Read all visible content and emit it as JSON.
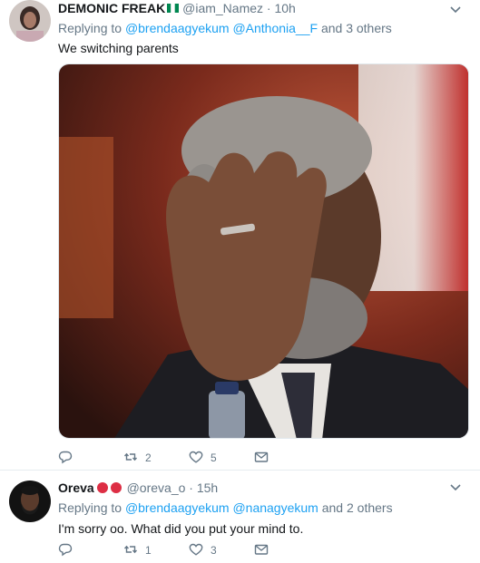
{
  "tweets": [
    {
      "name": "DEMONIC FREAK",
      "handle": "@iam_Namez",
      "separator": "·",
      "time": "10h",
      "replying_prefix": "Replying to ",
      "mention1": "@brendaagyekum",
      "mention2": "@Anthonia__F",
      "replying_suffix": " and 3 others",
      "text": "We switching parents",
      "reply_count": "",
      "retweet_count": "2",
      "like_count": "5",
      "name_emoji": "nigeria-flag"
    },
    {
      "name": "Oreva",
      "handle": "@oreva_o",
      "separator": "·",
      "time": "15h",
      "replying_prefix": "Replying to ",
      "mention1": "@brendaagyekum",
      "mention2": "@nanagyekum",
      "replying_suffix": " and 2 others",
      "text": "I'm sorry oo. What did you put your mind to.",
      "reply_count": "",
      "retweet_count": "1",
      "like_count": "3",
      "name_emoji": "two-red-circles"
    }
  ],
  "colors": {
    "link": "#1da1f2",
    "secondary": "#657786",
    "flag_green": "#008751",
    "red_circle": "#dd2e44"
  }
}
